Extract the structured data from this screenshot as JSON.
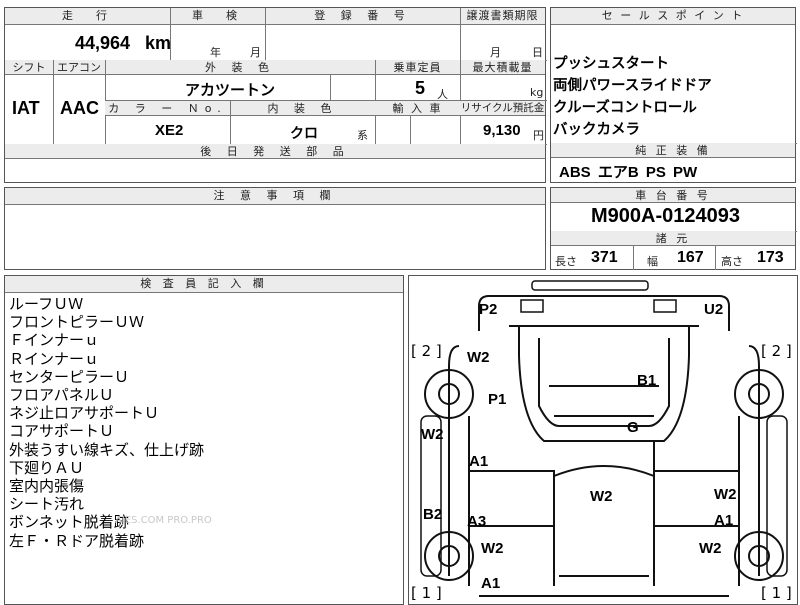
{
  "top_row": {
    "h_mileage": "走　行",
    "h_inspection": "車　検",
    "h_registration": "登 録 番 号",
    "h_transfer": "譲渡書類期限",
    "mileage": "44,964",
    "mileage_unit": "km",
    "insp_year": "年",
    "insp_month": "月",
    "transfer_month": "月",
    "transfer_day": "日"
  },
  "mid_row": {
    "h_shift": "シフト",
    "h_ac": "エアコン",
    "h_exterior_color": "外 装 色",
    "h_capacity": "乗車定員",
    "h_max_load": "最大積載量",
    "shift": "IAT",
    "ac": "AAC",
    "exterior_color": "アカツートン",
    "capacity": "5",
    "capacity_unit": "人",
    "load_unit": "kg",
    "h_color_no": "カ ラ ー Ｎo.",
    "h_interior_color": "内 装 色",
    "h_import": "輸 入 車",
    "h_recycle": "リサイクル預託金",
    "color_no": "XE2",
    "interior_color": "クロ",
    "interior_suffix": "系",
    "recycle_fee": "9,130",
    "recycle_unit": "円",
    "h_parts": "後 日 発 送 部 品"
  },
  "sales_points": {
    "header": "セ ー ル ス ポ イ ン ト",
    "items": [
      "プッシュスタート",
      "両側パワースライドドア",
      "クルーズコントロール",
      "バックカメラ"
    ],
    "equip_header": "純 正 装 備",
    "equipment": "ABS エアB PS PW"
  },
  "notes_section": {
    "header": "注 意 事 項 欄"
  },
  "chassis": {
    "header": "車 台 番 号",
    "number": "M900A-0124093",
    "spec_header": "諸 元",
    "length_label": "長さ",
    "length": "371",
    "width_label": "幅",
    "width": "167",
    "height_label": "高さ",
    "height": "173"
  },
  "inspector": {
    "header": "検 査 員 記 入 欄",
    "notes": [
      "ルーフＵＷ",
      "フロントピラーＵＷ",
      "Ｆインナーｕ",
      "Ｒインナーｕ",
      "センターピラーＵ",
      "フロアパネルＵ",
      "ネジ止ロアサポートＵ",
      "コアサポートＵ",
      "外装うすい線キズ、仕上げ跡",
      "下廻りＡＵ",
      "室内内張傷",
      "シート汚れ",
      "ボンネット脱着跡",
      "左Ｆ・Ｒドア脱着跡"
    ],
    "watermark": "AJES.COM PRO.PRO"
  },
  "diagram": {
    "marks": [
      {
        "id": "p2-rear",
        "text": "P2"
      },
      {
        "id": "u2-rear",
        "text": "U2"
      },
      {
        "id": "w2-left-rear",
        "text": "W2"
      },
      {
        "id": "p1-roof-left",
        "text": "P1"
      },
      {
        "id": "b1-roof",
        "text": "B1"
      },
      {
        "id": "w2-left-side",
        "text": "W2"
      },
      {
        "id": "g-glass",
        "text": "G"
      },
      {
        "id": "a1-left-door",
        "text": "A1"
      },
      {
        "id": "w2-hood",
        "text": "W2"
      },
      {
        "id": "w2-right-side",
        "text": "W2"
      },
      {
        "id": "b2-left",
        "text": "B2"
      },
      {
        "id": "a3-left-door",
        "text": "A3"
      },
      {
        "id": "a1-right-door",
        "text": "A1"
      },
      {
        "id": "w2-left-front",
        "text": "W2"
      },
      {
        "id": "w2-right-front",
        "text": "W2"
      },
      {
        "id": "a1-front",
        "text": "A1"
      }
    ],
    "tire_labels": [
      {
        "id": "tire-rl",
        "text": "[ 2 ]"
      },
      {
        "id": "tire-rr",
        "text": "[ 2 ]"
      },
      {
        "id": "tire-fl",
        "text": "[ 1 ]"
      },
      {
        "id": "tire-fr",
        "text": "[ 1 ]"
      }
    ]
  }
}
